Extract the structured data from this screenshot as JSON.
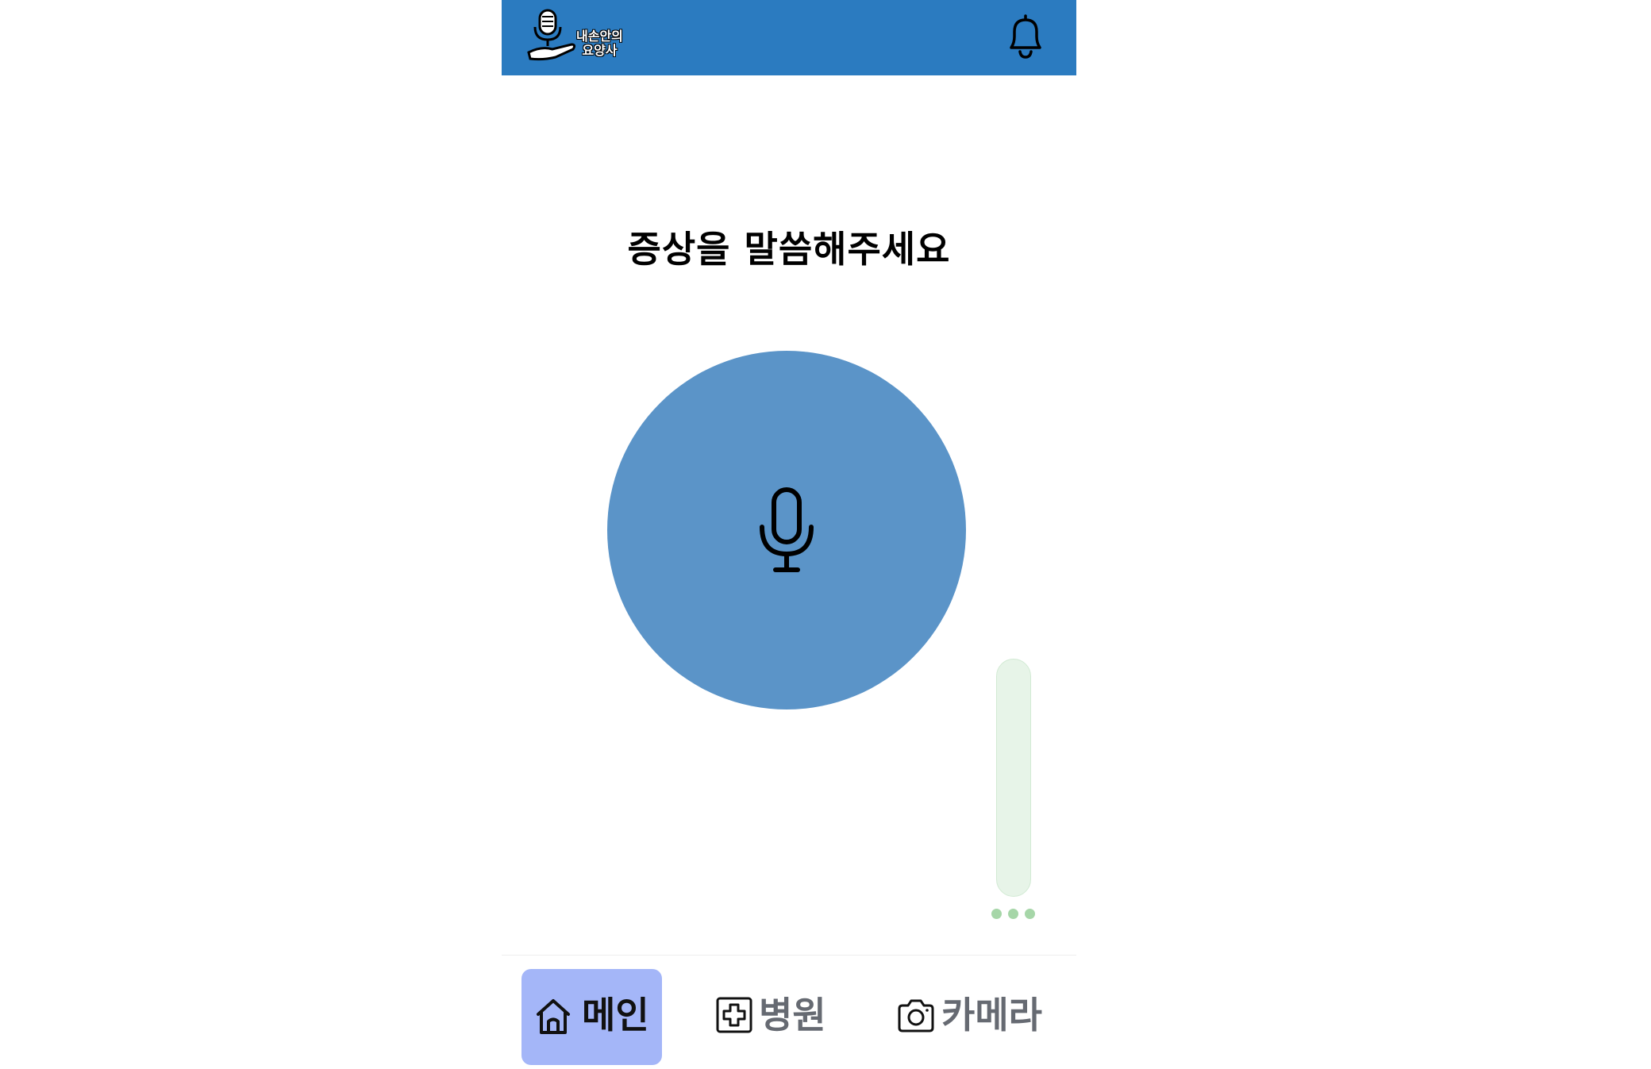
{
  "header": {
    "logo_line1": "내손안의",
    "logo_line2": "요양사",
    "bell_icon": "bell-icon",
    "background": "#2b7bc0"
  },
  "main": {
    "prompt": "증상을 말씀해주세요",
    "mic_icon": "microphone-icon",
    "mic_button_color": "#5b94c8"
  },
  "nav": {
    "items": [
      {
        "label": "메인",
        "icon": "home-icon",
        "active": true
      },
      {
        "label": "병원",
        "icon": "hospital-cross-icon",
        "active": false
      },
      {
        "label": "카메라",
        "icon": "camera-icon",
        "active": false
      }
    ],
    "active_color": "#a4b6f8"
  }
}
